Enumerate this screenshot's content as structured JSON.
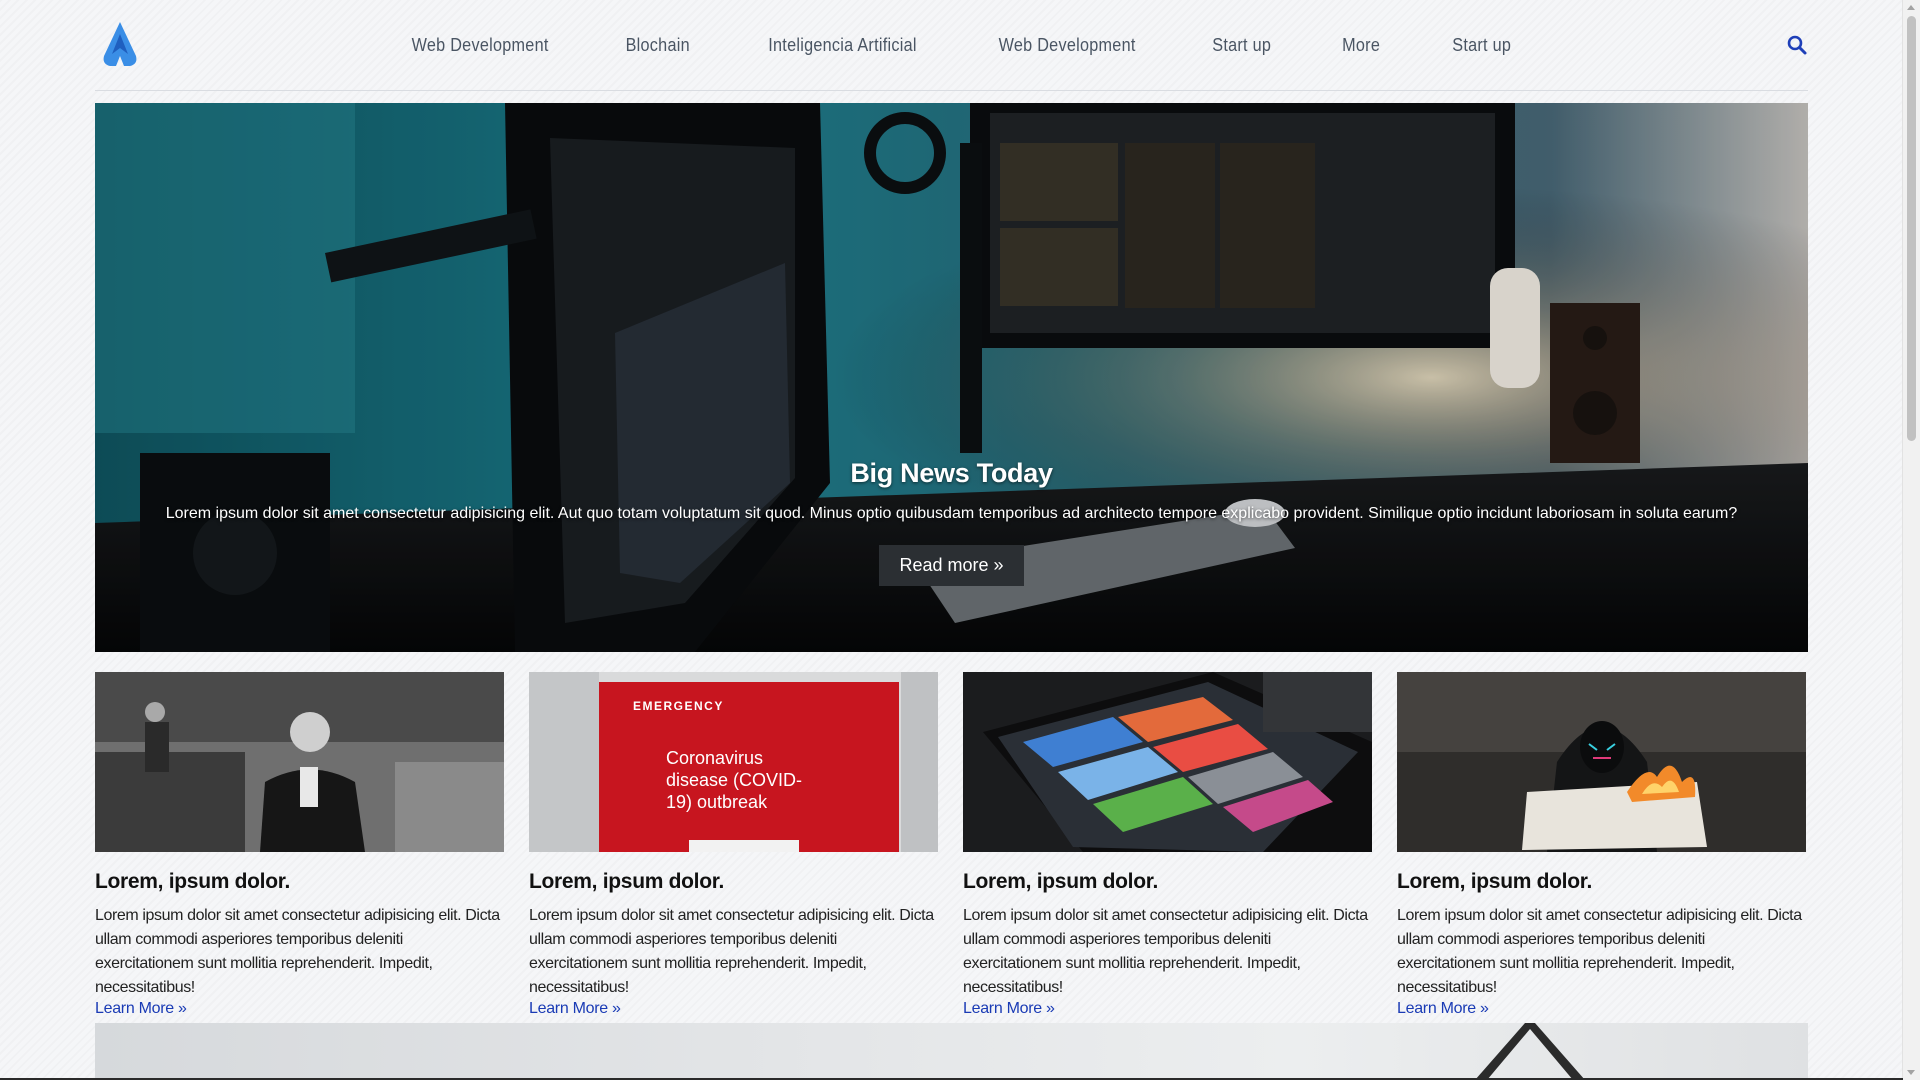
{
  "nav": {
    "logo_icon": "flame-logo-icon",
    "links": [
      {
        "label": "Web Development"
      },
      {
        "label": "Blochain"
      },
      {
        "label": "Inteligencia Artificial"
      },
      {
        "label": "Web Development"
      },
      {
        "label": "Start up"
      },
      {
        "label": "More"
      },
      {
        "label": "Start up"
      }
    ],
    "search_icon": "search-icon"
  },
  "hero": {
    "title": "Big News Today",
    "text": "Lorem ipsum dolor sit amet consectetur adipisicing elit. Aut quo totam voluptatum sit quod. Minus optio quibusdam temporibus ad architecto tempore explicabo provident. Similique optio incidunt laboriosam in soluta earum?",
    "button_label": "Read more »"
  },
  "cards": [
    {
      "image": "presenter-newsroom-photo",
      "title": "Lorem, ipsum dolor.",
      "text": "Lorem ipsum dolor sit amet consectetur adipisicing elit. Dicta ullam commodi asperiores temporibus deleniti exercitationem sunt mollitia reprehenderit. Impedit, necessitatibus!",
      "link_label": "Learn More »"
    },
    {
      "image": "covid-emergency-sign-photo",
      "image_text": [
        "EMERGENCY",
        "Coronavirus",
        "disease (COVID-",
        "19) outbreak"
      ],
      "title": "Lorem, ipsum dolor.",
      "text": "Lorem ipsum dolor sit amet consectetur adipisicing elit. Dicta ullam commodi asperiores temporibus deleniti exercitationem sunt mollitia reprehenderit. Impedit, necessitatibus!",
      "link_label": "Learn More »"
    },
    {
      "image": "tablet-news-app-photo",
      "title": "Lorem, ipsum dolor.",
      "text": "Lorem ipsum dolor sit amet consectetur adipisicing elit. Dicta ullam commodi asperiores temporibus deleniti exercitationem sunt mollitia reprehenderit. Impedit, necessitatibus!",
      "link_label": "Learn More »"
    },
    {
      "image": "hooded-figure-burning-newspaper-photo",
      "title": "Lorem, ipsum dolor.",
      "text": "Lorem ipsum dolor sit amet consectetur adipisicing elit. Dicta ullam commodi asperiores temporibus deleniti exercitationem sunt mollitia reprehenderit. Impedit, necessitatibus!",
      "link_label": "Learn More »"
    }
  ],
  "colors": {
    "nav_text": "#4a5563",
    "link": "#1a3bb5",
    "logo": "#3a8ee6",
    "hero_button": "#2b2f33"
  }
}
